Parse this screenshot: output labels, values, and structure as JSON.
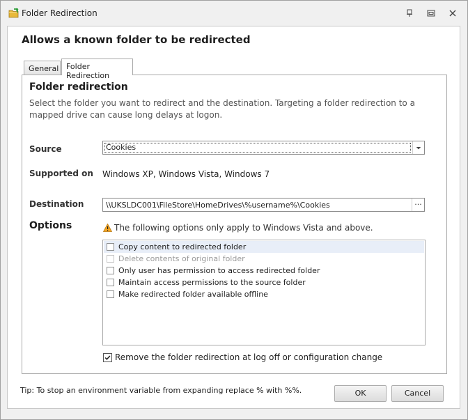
{
  "window": {
    "title": "Folder Redirection"
  },
  "dialog": {
    "heading": "Allows a known folder to be redirected"
  },
  "tabs": [
    {
      "label": "General"
    },
    {
      "label": "Folder Redirection"
    }
  ],
  "panel": {
    "title": "Folder redirection",
    "description": "Select the folder you want to redirect and the destination. Targeting a folder redirection to a mapped drive can cause long delays at logon."
  },
  "source": {
    "label": "Source",
    "value": "Cookies"
  },
  "supported": {
    "label": "Supported on",
    "value": "Windows XP, Windows Vista, Windows 7"
  },
  "destination": {
    "label": "Destination",
    "value": "\\\\UKSLDC001\\FileStore\\HomeDrives\\%username%\\Cookies",
    "browse_label": "..."
  },
  "options": {
    "label": "Options",
    "warning": "The following options only apply to Windows Vista and above.",
    "items": [
      {
        "label": "Copy content to redirected folder",
        "checked": false,
        "enabled": true
      },
      {
        "label": "Delete contents of original folder",
        "checked": false,
        "enabled": false
      },
      {
        "label": "Only user has permission to access redirected folder",
        "checked": false,
        "enabled": true
      },
      {
        "label": "Maintain access permissions to the source folder",
        "checked": false,
        "enabled": true
      },
      {
        "label": "Make redirected folder available offline",
        "checked": false,
        "enabled": true
      }
    ],
    "remove_label": "Remove the folder redirection at log off or configuration change",
    "remove_checked": true
  },
  "footer": {
    "tip": "Tip: To stop an environment variable from expanding replace % with %%.",
    "ok_label": "OK",
    "cancel_label": "Cancel"
  },
  "colors": {
    "window_bg": "#f0f0f0",
    "selection_bg": "#e8eef8",
    "warning_amber": "#f5a623"
  }
}
